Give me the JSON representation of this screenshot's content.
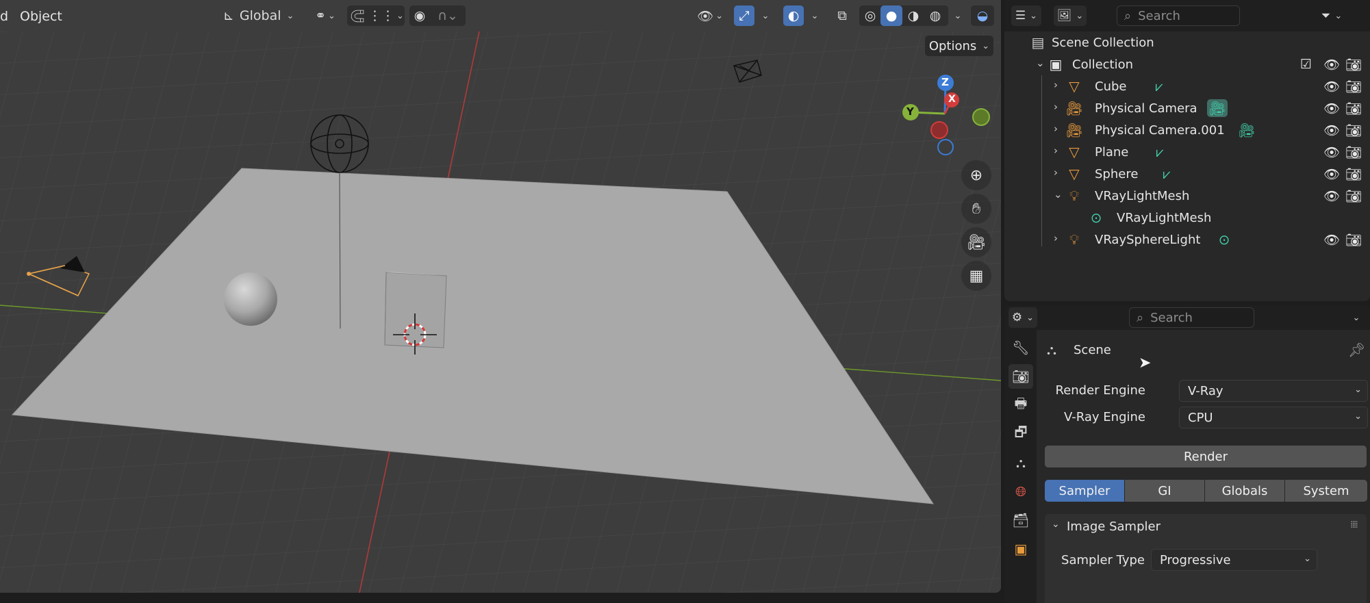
{
  "header": {
    "object_menu_partial": "d",
    "object_menu": "Object",
    "transform_orientation": "Global",
    "options_label": "Options"
  },
  "gizmo": {
    "z": "Z",
    "y": "Y",
    "x": "X"
  },
  "outliner": {
    "search_placeholder": "Search",
    "scene_collection": "Scene Collection",
    "collection": "Collection",
    "items": [
      {
        "label": "Cube",
        "type": "mesh"
      },
      {
        "label": "Physical Camera",
        "type": "camera"
      },
      {
        "label": "Physical Camera.001",
        "type": "camera"
      },
      {
        "label": "Plane",
        "type": "mesh"
      },
      {
        "label": "Sphere",
        "type": "mesh"
      },
      {
        "label": "VRayLightMesh",
        "type": "light",
        "expanded": true
      },
      {
        "label": "VRayLightMesh",
        "type": "light-data"
      },
      {
        "label": "VRaySphereLight",
        "type": "light"
      }
    ]
  },
  "properties": {
    "search_placeholder": "Search",
    "context": "Scene",
    "render_engine_label": "Render Engine",
    "render_engine_value": "V-Ray",
    "vray_engine_label": "V-Ray Engine",
    "vray_engine_value": "CPU",
    "render_button": "Render",
    "tabs": [
      "Sampler",
      "GI",
      "Globals",
      "System"
    ],
    "active_tab": "Sampler",
    "panel_title": "Image Sampler",
    "sampler_type_label": "Sampler Type",
    "sampler_type_value": "Progressive"
  },
  "colors": {
    "accent": "#4772b3",
    "object_orange": "#e89b3c",
    "data_green": "#41c9a4"
  }
}
